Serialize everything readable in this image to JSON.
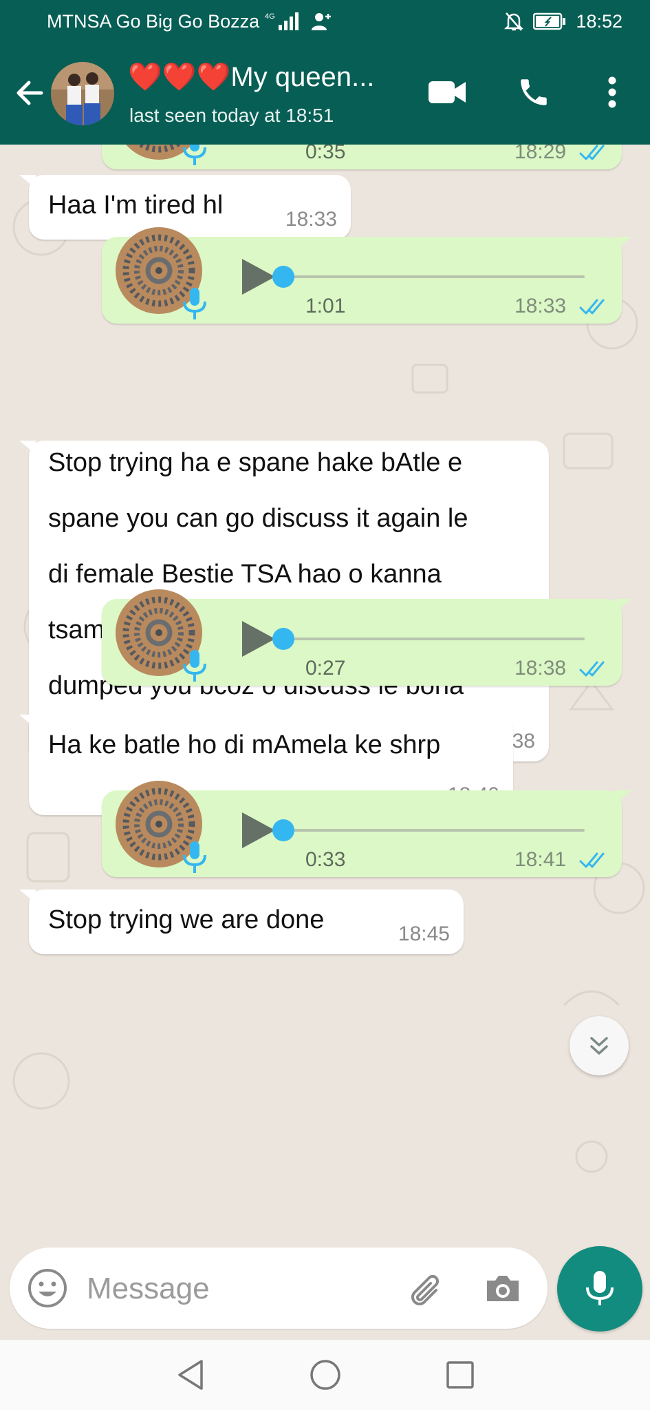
{
  "status_bar": {
    "carrier": "MTNSA Go Big Go Bozza",
    "network": "4G",
    "time": "18:52"
  },
  "header": {
    "contact_name": "❤️❤️❤️My queen...",
    "last_seen": "last seen today at 18:51"
  },
  "messages": [
    {
      "type": "voice",
      "direction": "out",
      "duration": "0:35",
      "time": "18:29",
      "status": "read",
      "progress": 0
    },
    {
      "type": "text",
      "direction": "in",
      "text": "Haa I'm tired hl",
      "time": "18:33"
    },
    {
      "type": "voice",
      "direction": "out",
      "duration": "1:01",
      "time": "18:33",
      "status": "read",
      "progress": 0
    },
    {
      "type": "text",
      "direction": "in",
      "lines": [
        "Stop trying ha e spane hake bAtle e",
        "spane you can go discuss it again le",
        "di female Bestie TSA hao o kanna",
        "tsamaya o lo ba jwetsA hore I",
        "dumped you bcoz o discuss le bona"
      ],
      "time": "18:38"
    },
    {
      "type": "voice",
      "direction": "out",
      "duration": "0:27",
      "time": "18:38",
      "status": "read",
      "progress": 0
    },
    {
      "type": "text",
      "direction": "in",
      "text": "Ha ke batle ho di mAmela ke shrp",
      "time": "18:40"
    },
    {
      "type": "voice",
      "direction": "out",
      "duration": "0:33",
      "time": "18:41",
      "status": "read",
      "progress": 0
    },
    {
      "type": "text",
      "direction": "in",
      "text": "Stop trying we are done",
      "time": "18:45"
    }
  ],
  "input": {
    "placeholder": "Message"
  },
  "colors": {
    "header": "#075e54",
    "outgoing_bubble": "#dcf8c6",
    "incoming_bubble": "#ffffff",
    "read_ticks": "#34b7f1",
    "fab": "#128c7e"
  },
  "icons": {
    "back": "arrow-left-icon",
    "video": "video-camera-icon",
    "call": "phone-icon",
    "menu": "more-vertical-icon",
    "emoji": "smiley-icon",
    "attach": "paperclip-icon",
    "camera": "camera-icon",
    "mic": "microphone-icon",
    "scroll": "double-chevron-down-icon"
  }
}
